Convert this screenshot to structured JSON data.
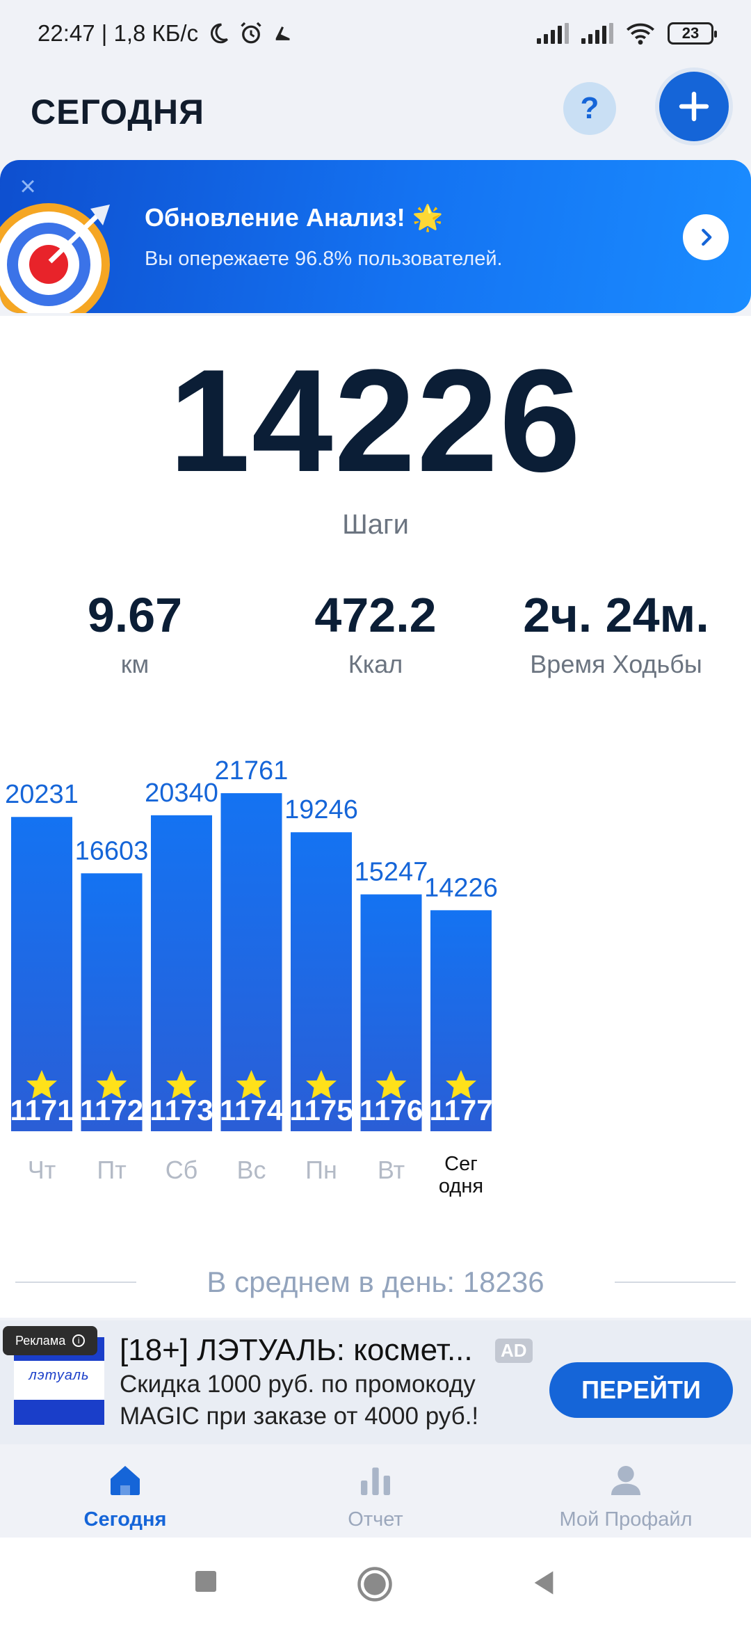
{
  "status_bar": {
    "time_speed": "22:47 | 1,8 КБ/с",
    "battery": "23"
  },
  "header": {
    "title": "СЕГОДНЯ",
    "help_label": "?"
  },
  "banner": {
    "title": "Обновление Анализ! 🌟",
    "subtitle": "Вы опережаете 96.8% пользователей."
  },
  "summary": {
    "steps": "14226",
    "steps_label": "Шаги",
    "distance_value": "9.67",
    "distance_label": "км",
    "calories_value": "472.2",
    "calories_label": "Ккал",
    "time_value": "2ч. 24м.",
    "time_label": "Время Ходьбы"
  },
  "chart_data": {
    "type": "bar",
    "categories": [
      "Чт",
      "Пт",
      "Сб",
      "Вс",
      "Пн",
      "Вт",
      "Сег одня"
    ],
    "values": [
      20231,
      16603,
      20340,
      21761,
      19246,
      15247,
      14226
    ],
    "badges": [
      1171,
      1172,
      1173,
      1174,
      1175,
      1176,
      1177
    ],
    "bar_color": "#1473f2",
    "bar_color_bottom": "#2a5ed6",
    "label_color": "#1565d8"
  },
  "average": {
    "text": "В среднем в день: 18236"
  },
  "ad": {
    "tag": "Реклама",
    "logo_text": "лэтуаль",
    "title": "[18+] ЛЭТУАЛЬ: космет...",
    "badge": "AD",
    "line1": "Скидка 1000 руб. по промокоду",
    "line2": "MAGIC при заказе от 4000 руб.!",
    "cta": "ПЕРЕЙТИ"
  },
  "bottom_nav": {
    "today": "Сегодня",
    "report": "Отчет",
    "profile": "Мой Профайл"
  },
  "colors": {
    "accent": "#1565d8",
    "text_dark": "#0b1e36",
    "muted": "#6b7480"
  }
}
